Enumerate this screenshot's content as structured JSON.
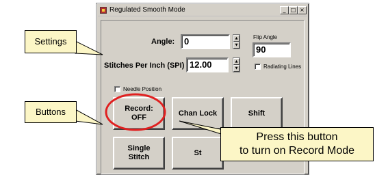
{
  "window": {
    "title": "Regulated Smooth Mode",
    "min_glyph": "_",
    "max_glyph": "□",
    "close_glyph": "×"
  },
  "settings": {
    "angle_label": "Angle:",
    "angle_value": "0",
    "spi_label": "Stitches Per Inch (SPI)",
    "spi_value": "12.00",
    "flip_angle_label": "Flip Angle",
    "flip_angle_value": "90",
    "radiating_lines_label": "Radiating Lines",
    "radiating_lines_checked": false,
    "needle_position_label": "Needle Position",
    "needle_position_checked": false,
    "spin_up": "▲",
    "spin_down": "▼"
  },
  "buttons": {
    "record": "Record:\nOFF",
    "chan_lock": "Chan Lock",
    "shift": "Shift",
    "single_stitch": "Single\nStitch",
    "partial": "St"
  },
  "annotations": {
    "settings_callout": "Settings",
    "buttons_callout": "Buttons",
    "record_tip": "Press this button\nto turn on Record Mode",
    "highlight_color": "#e02020",
    "callout_fill": "#fcf6c6"
  }
}
